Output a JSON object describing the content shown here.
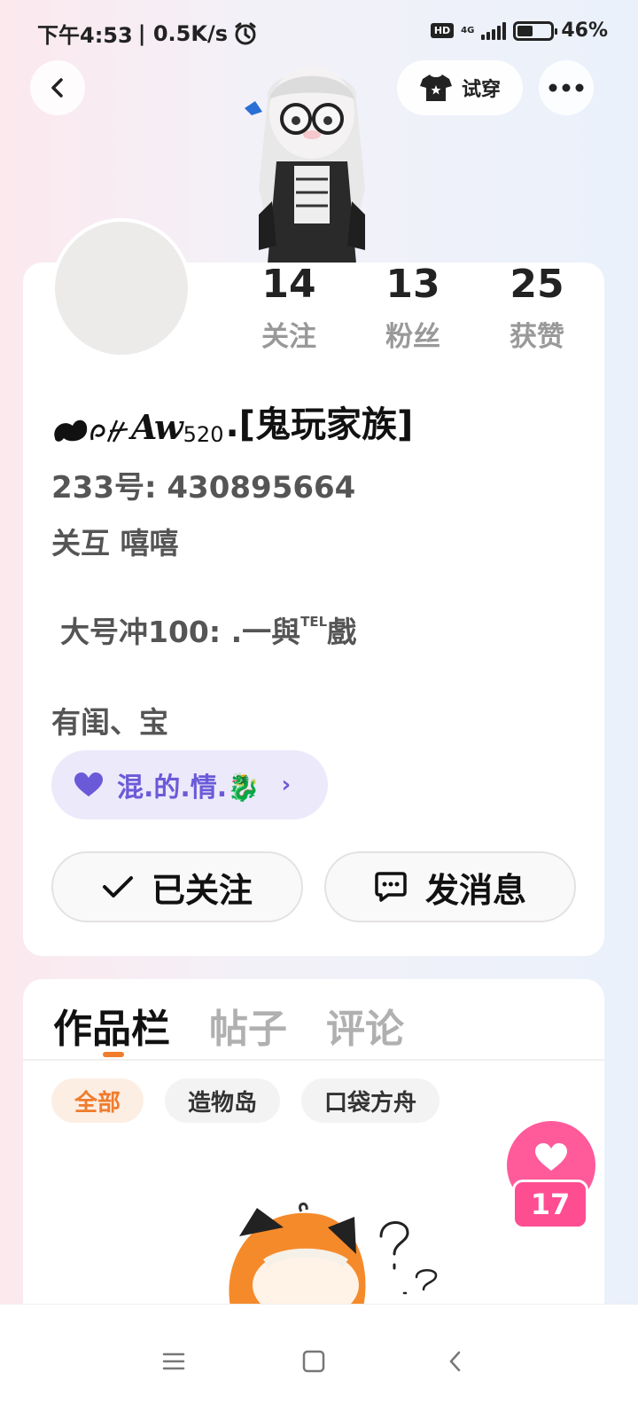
{
  "status_bar": {
    "time": "下午4:53",
    "speed": "| 0.5K/s",
    "hd": "HD",
    "network": "4G",
    "battery": "46%",
    "battery_level": 0.46
  },
  "header": {
    "try_on_label": "试穿"
  },
  "profile": {
    "stats": [
      {
        "value": "14",
        "label": "关注"
      },
      {
        "value": "13",
        "label": "粉丝"
      },
      {
        "value": "25",
        "label": "获赞"
      }
    ],
    "username_deco": "Aw",
    "username_sub": "520",
    "username_main": ".[鬼玩家族]",
    "uid": "233号: 430895664",
    "bio_line1": "关互 嘻嘻",
    "bio_line2_main": "大号冲100: .一與",
    "bio_line2_sup": "TEL",
    "bio_line2_end": "戲",
    "bio_line3": "有闺、宝",
    "family_tag": "混.的.情.🐉",
    "follow_label": "已关注",
    "message_label": "发消息"
  },
  "works": {
    "tabs": [
      "作品栏",
      "帖子",
      "评论"
    ],
    "filters": [
      "全部",
      "造物岛",
      "口袋方舟"
    ],
    "like_count": "17"
  },
  "colors": {
    "accent_orange": "#f07c2c",
    "family_purple": "#6b5ad8",
    "like_pink": "#ff4d92"
  }
}
